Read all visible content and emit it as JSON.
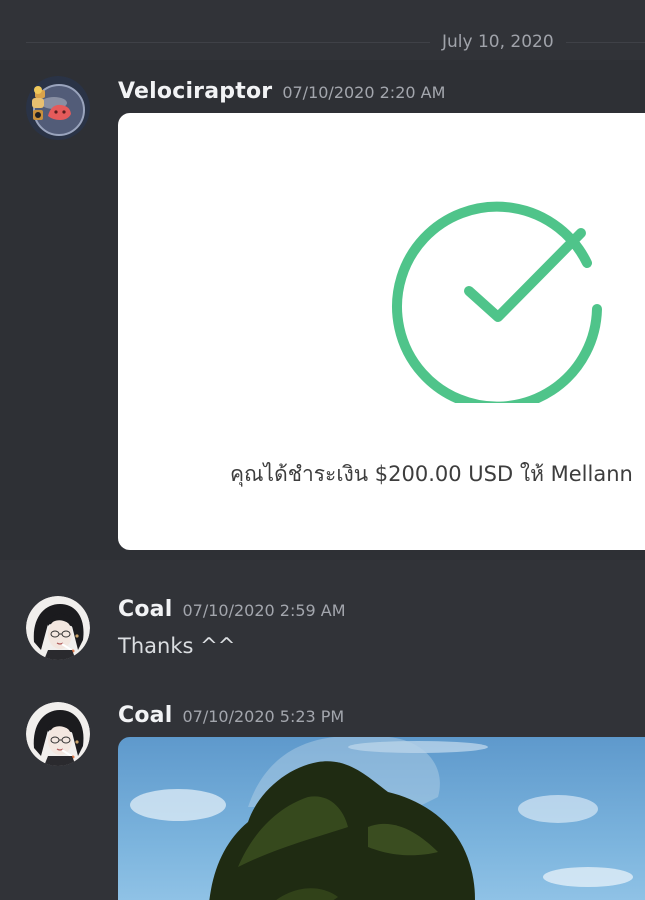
{
  "divider": {
    "date": "July 10, 2020"
  },
  "messages": [
    {
      "username": "Velociraptor",
      "timestamp": "07/10/2020 2:20 AM",
      "avatar_icon": "raptor-avatar-icon",
      "attachment": {
        "type": "payment-receipt-image",
        "icon": "check-circle-icon",
        "accent_color": "#4fc48a",
        "text": "คุณได้ชำระเงิน $200.00 USD ให้ Mellann"
      }
    },
    {
      "username": "Coal",
      "timestamp": "07/10/2020 2:59 AM",
      "avatar_icon": "user-portrait-avatar-icon",
      "text": "Thanks ^^"
    },
    {
      "username": "Coal",
      "timestamp": "07/10/2020 5:23 PM",
      "avatar_icon": "user-portrait-avatar-icon",
      "attachment": {
        "type": "photo",
        "icon": "tree-sky-photo"
      }
    }
  ],
  "colors": {
    "background": "#313338",
    "hover_background": "#2e3035",
    "username": "#f2f3f5",
    "timestamp": "#a3a6ad",
    "text": "#dbdee1",
    "check_green": "#4fc48a"
  }
}
